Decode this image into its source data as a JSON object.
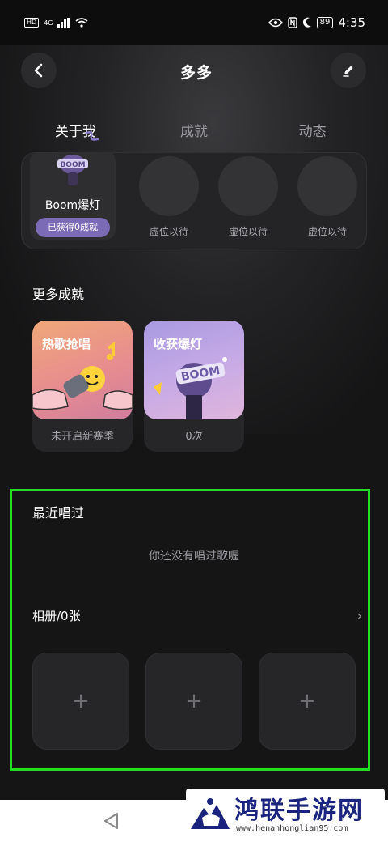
{
  "status_bar": {
    "hd": "HD",
    "network": "4G",
    "battery": "89",
    "time": "4:35"
  },
  "nav": {
    "title": "多多"
  },
  "tabs": [
    {
      "label": "关于我",
      "active": true
    },
    {
      "label": "成就",
      "active": false
    },
    {
      "label": "动态",
      "active": false
    }
  ],
  "achievements": {
    "main": {
      "name": "Boom爆灯",
      "badge": "已获得0成就"
    },
    "placeholders": [
      "虚位以待",
      "虚位以待",
      "虚位以待"
    ]
  },
  "more_achievements": {
    "title": "更多成就",
    "cards": [
      {
        "title": "热歌抢唱",
        "caption": "未开启新赛季"
      },
      {
        "title": "收获爆灯",
        "caption": "0次"
      }
    ]
  },
  "recent": {
    "title": "最近唱过",
    "empty_text": "你还没有唱过歌喔"
  },
  "album": {
    "title": "相册/0张",
    "chevron": "›",
    "slots": [
      "+",
      "+",
      "+"
    ]
  },
  "watermark": {
    "title": "鸿联手游网",
    "url": "www.henanhonglian95.com"
  },
  "colors": {
    "accent_purple": "#7b6ab5",
    "highlight_green": "#22dd22",
    "background": "#151516"
  }
}
